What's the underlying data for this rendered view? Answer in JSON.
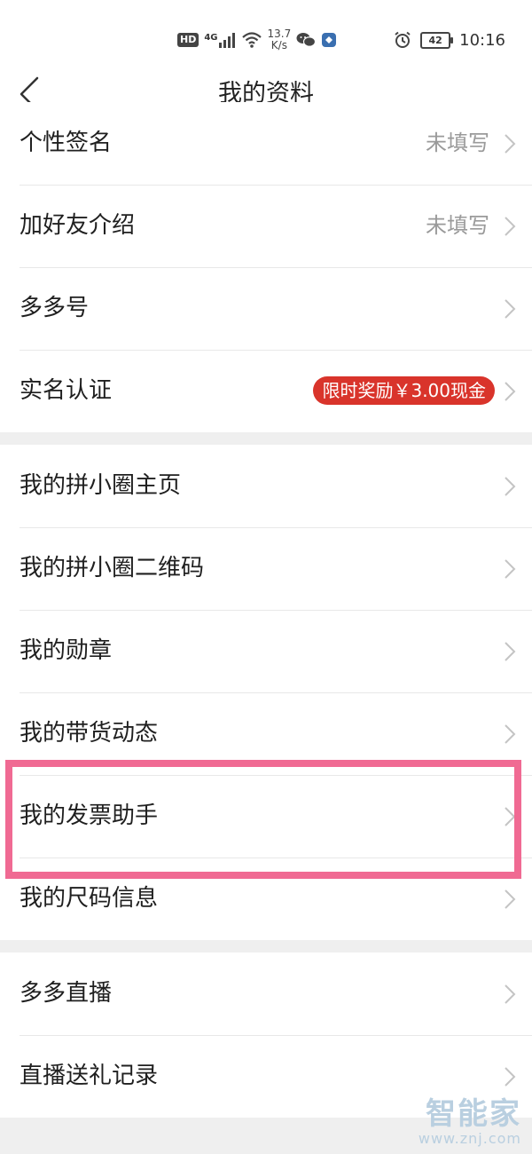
{
  "status_bar": {
    "hd": "HD",
    "network": "4G",
    "speed_value": "13.7",
    "speed_unit": "K/s",
    "battery": "42",
    "time": "10:16"
  },
  "header": {
    "title": "我的资料"
  },
  "section1": {
    "items": [
      {
        "label": "个性签名",
        "value": "未填写"
      },
      {
        "label": "加好友介绍",
        "value": "未填写"
      },
      {
        "label": "多多号"
      },
      {
        "label": "实名认证",
        "badge": "限时奖励￥3.00现金"
      }
    ]
  },
  "section2": {
    "items": [
      {
        "label": "我的拼小圈主页"
      },
      {
        "label": "我的拼小圈二维码"
      },
      {
        "label": "我的勋章"
      },
      {
        "label": "我的带货动态"
      },
      {
        "label": "我的发票助手"
      },
      {
        "label": "我的尺码信息"
      }
    ]
  },
  "section3": {
    "items": [
      {
        "label": "多多直播"
      },
      {
        "label": "直播送礼记录"
      }
    ]
  },
  "watermark": {
    "logo": "智能家",
    "url": "www.znj.com"
  },
  "colors": {
    "badge": "#d9342b",
    "highlight": "#f06a93",
    "divider_band": "#efefef"
  }
}
